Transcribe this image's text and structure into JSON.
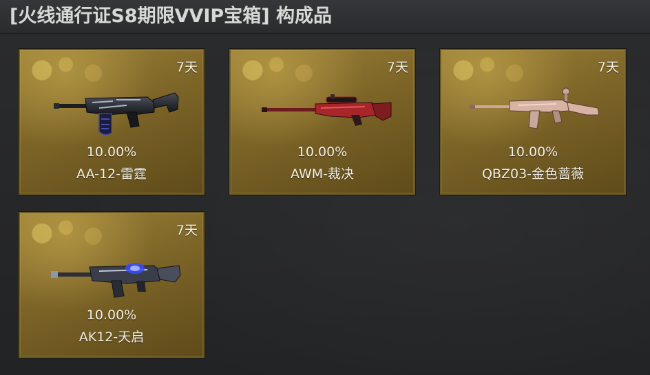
{
  "title": "[火线通行证S8期限VVIP宝箱] 构成品",
  "items": [
    {
      "days": "7天",
      "rate": "10.00%",
      "name": "AA-12-雷霆",
      "weapon_icon": "shotgun-aa12-icon"
    },
    {
      "days": "7天",
      "rate": "10.00%",
      "name": "AWM-裁决",
      "weapon_icon": "sniper-awm-icon"
    },
    {
      "days": "7天",
      "rate": "10.00%",
      "name": "QBZ03-金色蔷薇",
      "weapon_icon": "rifle-qbz03-icon"
    },
    {
      "days": "7天",
      "rate": "10.00%",
      "name": "AK12-天启",
      "weapon_icon": "rifle-ak12-icon"
    }
  ],
  "colors": {
    "card_gold": "#7d6528",
    "card_border": "#6c5a25",
    "text": "#f4f1e6",
    "background": "#262728"
  }
}
